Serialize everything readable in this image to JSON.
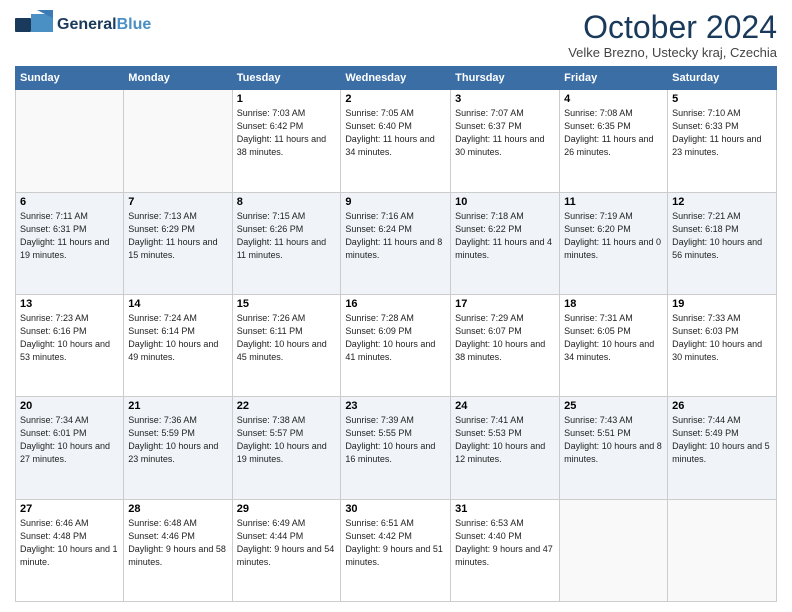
{
  "header": {
    "logo_general": "General",
    "logo_blue": "Blue",
    "month": "October 2024",
    "location": "Velke Brezno, Ustecky kraj, Czechia"
  },
  "days_of_week": [
    "Sunday",
    "Monday",
    "Tuesday",
    "Wednesday",
    "Thursday",
    "Friday",
    "Saturday"
  ],
  "weeks": [
    [
      {
        "day": "",
        "info": ""
      },
      {
        "day": "",
        "info": ""
      },
      {
        "day": "1",
        "info": "Sunrise: 7:03 AM\nSunset: 6:42 PM\nDaylight: 11 hours and 38 minutes."
      },
      {
        "day": "2",
        "info": "Sunrise: 7:05 AM\nSunset: 6:40 PM\nDaylight: 11 hours and 34 minutes."
      },
      {
        "day": "3",
        "info": "Sunrise: 7:07 AM\nSunset: 6:37 PM\nDaylight: 11 hours and 30 minutes."
      },
      {
        "day": "4",
        "info": "Sunrise: 7:08 AM\nSunset: 6:35 PM\nDaylight: 11 hours and 26 minutes."
      },
      {
        "day": "5",
        "info": "Sunrise: 7:10 AM\nSunset: 6:33 PM\nDaylight: 11 hours and 23 minutes."
      }
    ],
    [
      {
        "day": "6",
        "info": "Sunrise: 7:11 AM\nSunset: 6:31 PM\nDaylight: 11 hours and 19 minutes."
      },
      {
        "day": "7",
        "info": "Sunrise: 7:13 AM\nSunset: 6:29 PM\nDaylight: 11 hours and 15 minutes."
      },
      {
        "day": "8",
        "info": "Sunrise: 7:15 AM\nSunset: 6:26 PM\nDaylight: 11 hours and 11 minutes."
      },
      {
        "day": "9",
        "info": "Sunrise: 7:16 AM\nSunset: 6:24 PM\nDaylight: 11 hours and 8 minutes."
      },
      {
        "day": "10",
        "info": "Sunrise: 7:18 AM\nSunset: 6:22 PM\nDaylight: 11 hours and 4 minutes."
      },
      {
        "day": "11",
        "info": "Sunrise: 7:19 AM\nSunset: 6:20 PM\nDaylight: 11 hours and 0 minutes."
      },
      {
        "day": "12",
        "info": "Sunrise: 7:21 AM\nSunset: 6:18 PM\nDaylight: 10 hours and 56 minutes."
      }
    ],
    [
      {
        "day": "13",
        "info": "Sunrise: 7:23 AM\nSunset: 6:16 PM\nDaylight: 10 hours and 53 minutes."
      },
      {
        "day": "14",
        "info": "Sunrise: 7:24 AM\nSunset: 6:14 PM\nDaylight: 10 hours and 49 minutes."
      },
      {
        "day": "15",
        "info": "Sunrise: 7:26 AM\nSunset: 6:11 PM\nDaylight: 10 hours and 45 minutes."
      },
      {
        "day": "16",
        "info": "Sunrise: 7:28 AM\nSunset: 6:09 PM\nDaylight: 10 hours and 41 minutes."
      },
      {
        "day": "17",
        "info": "Sunrise: 7:29 AM\nSunset: 6:07 PM\nDaylight: 10 hours and 38 minutes."
      },
      {
        "day": "18",
        "info": "Sunrise: 7:31 AM\nSunset: 6:05 PM\nDaylight: 10 hours and 34 minutes."
      },
      {
        "day": "19",
        "info": "Sunrise: 7:33 AM\nSunset: 6:03 PM\nDaylight: 10 hours and 30 minutes."
      }
    ],
    [
      {
        "day": "20",
        "info": "Sunrise: 7:34 AM\nSunset: 6:01 PM\nDaylight: 10 hours and 27 minutes."
      },
      {
        "day": "21",
        "info": "Sunrise: 7:36 AM\nSunset: 5:59 PM\nDaylight: 10 hours and 23 minutes."
      },
      {
        "day": "22",
        "info": "Sunrise: 7:38 AM\nSunset: 5:57 PM\nDaylight: 10 hours and 19 minutes."
      },
      {
        "day": "23",
        "info": "Sunrise: 7:39 AM\nSunset: 5:55 PM\nDaylight: 10 hours and 16 minutes."
      },
      {
        "day": "24",
        "info": "Sunrise: 7:41 AM\nSunset: 5:53 PM\nDaylight: 10 hours and 12 minutes."
      },
      {
        "day": "25",
        "info": "Sunrise: 7:43 AM\nSunset: 5:51 PM\nDaylight: 10 hours and 8 minutes."
      },
      {
        "day": "26",
        "info": "Sunrise: 7:44 AM\nSunset: 5:49 PM\nDaylight: 10 hours and 5 minutes."
      }
    ],
    [
      {
        "day": "27",
        "info": "Sunrise: 6:46 AM\nSunset: 4:48 PM\nDaylight: 10 hours and 1 minute."
      },
      {
        "day": "28",
        "info": "Sunrise: 6:48 AM\nSunset: 4:46 PM\nDaylight: 9 hours and 58 minutes."
      },
      {
        "day": "29",
        "info": "Sunrise: 6:49 AM\nSunset: 4:44 PM\nDaylight: 9 hours and 54 minutes."
      },
      {
        "day": "30",
        "info": "Sunrise: 6:51 AM\nSunset: 4:42 PM\nDaylight: 9 hours and 51 minutes."
      },
      {
        "day": "31",
        "info": "Sunrise: 6:53 AM\nSunset: 4:40 PM\nDaylight: 9 hours and 47 minutes."
      },
      {
        "day": "",
        "info": ""
      },
      {
        "day": "",
        "info": ""
      }
    ]
  ]
}
